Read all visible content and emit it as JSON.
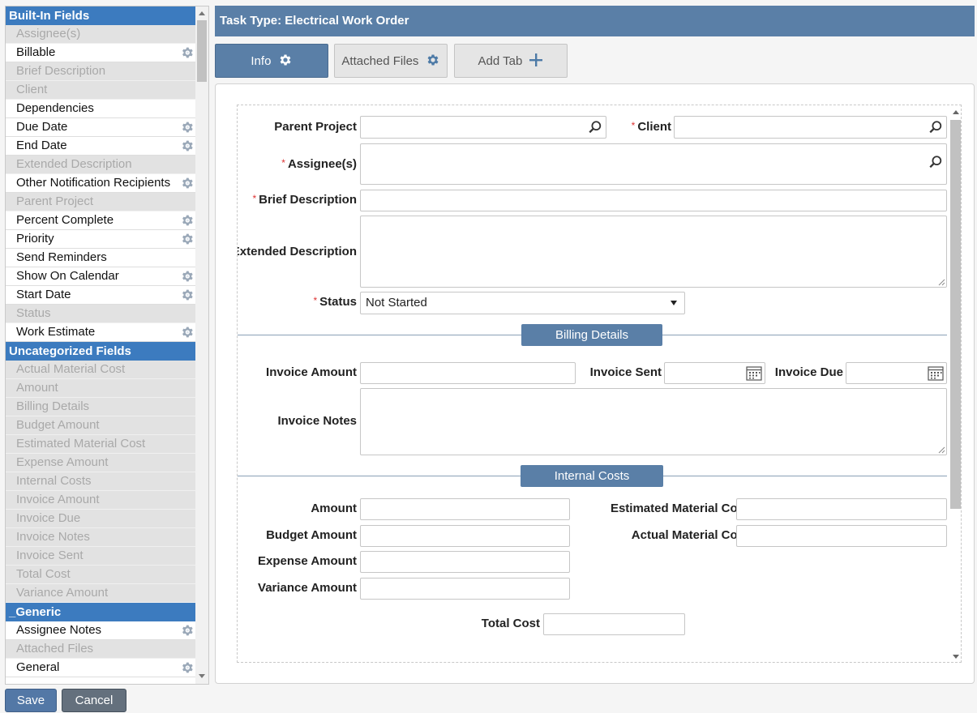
{
  "left_panel": {
    "groups": [
      {
        "title": "Built-In Fields",
        "fields": [
          {
            "label": "Assignee(s)",
            "enabled": false,
            "gear": false
          },
          {
            "label": "Billable",
            "enabled": true,
            "gear": true
          },
          {
            "label": "Brief Description",
            "enabled": false,
            "gear": false
          },
          {
            "label": "Client",
            "enabled": false,
            "gear": false
          },
          {
            "label": "Dependencies",
            "enabled": true,
            "gear": false
          },
          {
            "label": "Due Date",
            "enabled": true,
            "gear": true
          },
          {
            "label": "End Date",
            "enabled": true,
            "gear": true
          },
          {
            "label": "Extended Description",
            "enabled": false,
            "gear": false
          },
          {
            "label": "Other Notification Recipients",
            "enabled": true,
            "gear": true
          },
          {
            "label": "Parent Project",
            "enabled": false,
            "gear": false
          },
          {
            "label": "Percent Complete",
            "enabled": true,
            "gear": true
          },
          {
            "label": "Priority",
            "enabled": true,
            "gear": true
          },
          {
            "label": "Send Reminders",
            "enabled": true,
            "gear": false
          },
          {
            "label": "Show On Calendar",
            "enabled": true,
            "gear": true
          },
          {
            "label": "Start Date",
            "enabled": true,
            "gear": true
          },
          {
            "label": "Status",
            "enabled": false,
            "gear": false
          },
          {
            "label": "Work Estimate",
            "enabled": true,
            "gear": true
          }
        ]
      },
      {
        "title": "Uncategorized Fields",
        "fields": [
          {
            "label": "Actual Material Cost",
            "enabled": false,
            "gear": false
          },
          {
            "label": "Amount",
            "enabled": false,
            "gear": false
          },
          {
            "label": "Billing Details",
            "enabled": false,
            "gear": false
          },
          {
            "label": "Budget Amount",
            "enabled": false,
            "gear": false
          },
          {
            "label": "Estimated Material Cost",
            "enabled": false,
            "gear": false
          },
          {
            "label": "Expense Amount",
            "enabled": false,
            "gear": false
          },
          {
            "label": "Internal Costs",
            "enabled": false,
            "gear": false
          },
          {
            "label": "Invoice Amount",
            "enabled": false,
            "gear": false
          },
          {
            "label": "Invoice Due",
            "enabled": false,
            "gear": false
          },
          {
            "label": "Invoice Notes",
            "enabled": false,
            "gear": false
          },
          {
            "label": "Invoice Sent",
            "enabled": false,
            "gear": false
          },
          {
            "label": "Total Cost",
            "enabled": false,
            "gear": false
          },
          {
            "label": "Variance Amount",
            "enabled": false,
            "gear": false
          }
        ]
      },
      {
        "title": "_Generic",
        "fields": [
          {
            "label": "Assignee Notes",
            "enabled": true,
            "gear": true
          },
          {
            "label": "Attached Files",
            "enabled": false,
            "gear": false
          },
          {
            "label": "General",
            "enabled": true,
            "gear": true
          }
        ]
      }
    ]
  },
  "buttons": {
    "save": "Save",
    "cancel": "Cancel"
  },
  "header": {
    "title": "Task Type: Electrical Work Order"
  },
  "tabs": {
    "info": "Info",
    "attached_files": "Attached Files",
    "add_tab": "Add Tab"
  },
  "form": {
    "parent_project": "Parent Project",
    "client": "Client",
    "assignees": "Assignee(s)",
    "brief_description": "Brief Description",
    "extended_description": "Extended Description",
    "status": "Status",
    "status_value": "Not Started",
    "billing_section": "Billing Details",
    "invoice_amount": "Invoice Amount",
    "invoice_sent": "Invoice Sent",
    "invoice_due": "Invoice Due",
    "invoice_notes": "Invoice Notes",
    "internal_section": "Internal Costs",
    "amount": "Amount",
    "estimated_material_cost": "Estimated Material Cost",
    "budget_amount": "Budget Amount",
    "actual_material_cost": "Actual Material Cost",
    "expense_amount": "Expense Amount",
    "variance_amount": "Variance Amount",
    "total_cost": "Total Cost"
  },
  "icons": {
    "gear": "gear-icon",
    "search": "search-icon",
    "calendar": "calendar-icon",
    "plus": "plus-icon"
  },
  "colors": {
    "accent": "#3c7bbf",
    "header": "#5a7fa7",
    "required": "#dd3333"
  }
}
